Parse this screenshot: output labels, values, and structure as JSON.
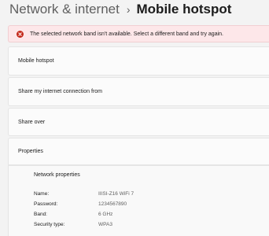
{
  "breadcrumb": {
    "parent": "Network & internet",
    "separator": "›",
    "current": "Mobile hotspot"
  },
  "alert": {
    "icon": "error-circle-icon",
    "color": "#c42b1c",
    "message": "The selected network band isn't available. Select a different band and try again."
  },
  "settings": {
    "mobile_hotspot": "Mobile hotspot",
    "share_from": "Share my internet connection from",
    "share_over": "Share over",
    "properties": "Properties"
  },
  "network_properties": {
    "heading": "Network properties",
    "rows": [
      {
        "label": "Name:",
        "value": "IIISI-Z16 WiFi 7"
      },
      {
        "label": "Password:",
        "value": "1234567890"
      },
      {
        "label": "Band:",
        "value": "6 GHz"
      },
      {
        "label": "Security type:",
        "value": "WPA3"
      }
    ]
  }
}
